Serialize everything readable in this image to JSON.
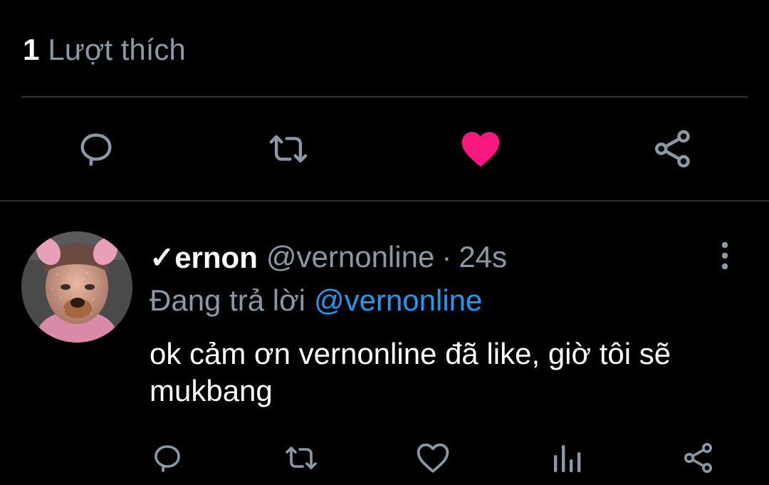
{
  "likes": {
    "count": "1",
    "label": "Lượt thích"
  },
  "colors": {
    "background": "#000000",
    "secondary_text": "#8b98a5",
    "divider": "#2f3336",
    "link": "#1d9bf0",
    "liked_heart": "#f91880"
  },
  "actions": {
    "reply_icon": "reply-icon",
    "retweet_icon": "retweet-icon",
    "like_icon": "heart-filled-icon",
    "share_icon": "share-icon",
    "liked": true
  },
  "reply": {
    "display_name": "✓ernon",
    "handle": "@vernonline",
    "separator": "·",
    "time": "24s",
    "replying_prefix": "Đang trả lời",
    "replying_to": "@vernonline",
    "text": "ok cảm ơn vernonline đã like, giờ tôi sẽ mukbang",
    "more_icon": "more-vertical-icon",
    "actions": [
      "reply-icon",
      "retweet-icon",
      "heart-outline-icon",
      "analytics-icon",
      "share-icon"
    ]
  }
}
